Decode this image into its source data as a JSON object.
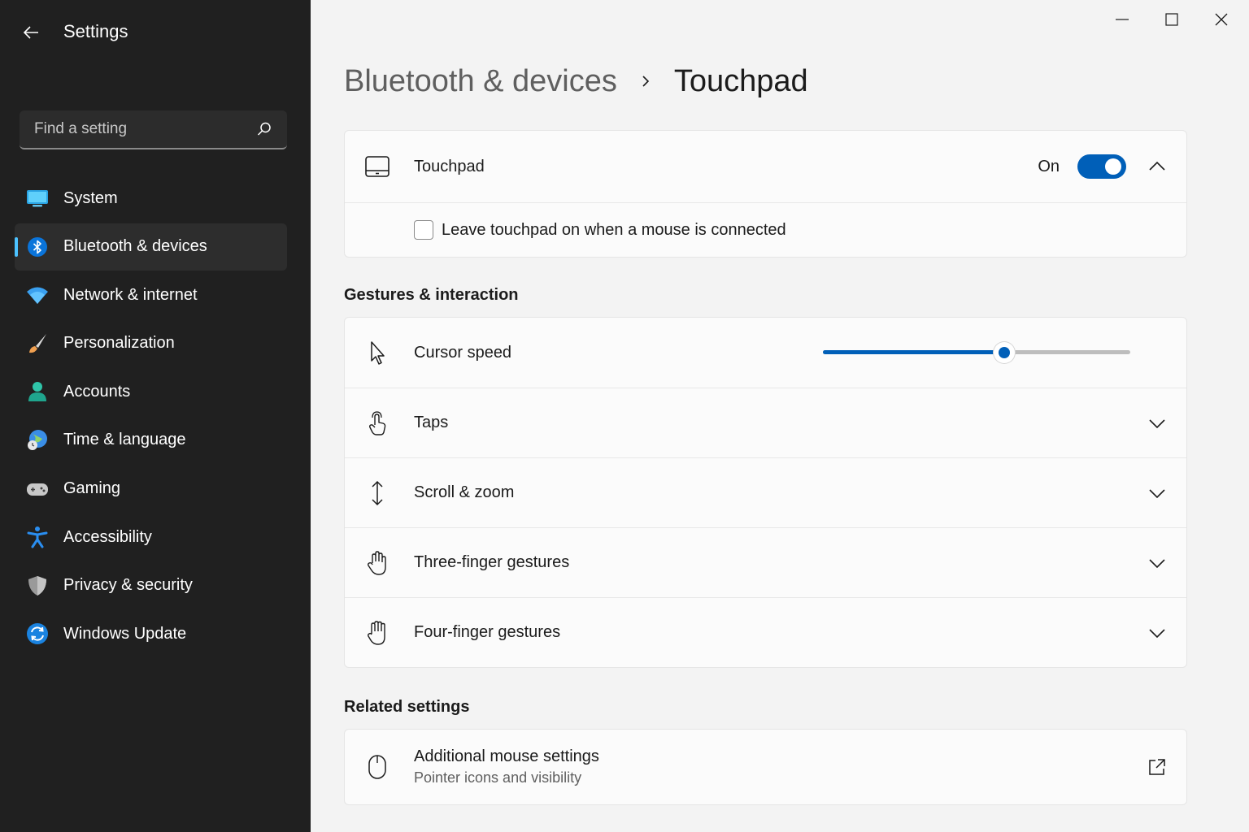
{
  "window": {
    "title": "Settings",
    "minimize_icon": "minimize-icon",
    "maximize_icon": "maximize-icon",
    "close_icon": "close-icon"
  },
  "search": {
    "placeholder": "Find a setting",
    "value": ""
  },
  "sidebar": {
    "items": [
      {
        "label": "System",
        "icon": "system-icon"
      },
      {
        "label": "Bluetooth & devices",
        "icon": "bluetooth-icon",
        "active": true
      },
      {
        "label": "Network & internet",
        "icon": "wifi-icon"
      },
      {
        "label": "Personalization",
        "icon": "brush-icon"
      },
      {
        "label": "Accounts",
        "icon": "person-icon"
      },
      {
        "label": "Time & language",
        "icon": "globe-clock-icon"
      },
      {
        "label": "Gaming",
        "icon": "gamepad-icon"
      },
      {
        "label": "Accessibility",
        "icon": "accessibility-icon"
      },
      {
        "label": "Privacy & security",
        "icon": "shield-icon"
      },
      {
        "label": "Windows Update",
        "icon": "update-icon"
      }
    ]
  },
  "breadcrumb": {
    "parent": "Bluetooth & devices",
    "current": "Touchpad"
  },
  "touchpad": {
    "label": "Touchpad",
    "toggle_state": "On",
    "enabled": true,
    "leave_on_label": "Leave touchpad on when a mouse is connected",
    "leave_on_checked": false
  },
  "gestures": {
    "heading": "Gestures & interaction",
    "cursor_speed": {
      "label": "Cursor speed",
      "value_fraction": 0.59
    },
    "rows": [
      {
        "label": "Taps",
        "icon": "tap-icon"
      },
      {
        "label": "Scroll & zoom",
        "icon": "scroll-icon"
      },
      {
        "label": "Three-finger gestures",
        "icon": "three-finger-icon"
      },
      {
        "label": "Four-finger gestures",
        "icon": "four-finger-icon"
      }
    ]
  },
  "related": {
    "heading": "Related settings",
    "mouse": {
      "label": "Additional mouse settings",
      "sub": "Pointer icons and visibility"
    }
  },
  "colors": {
    "accent": "#005fb8",
    "sidebar_bg": "#202020",
    "selected_indicator": "#4cc2ff"
  }
}
